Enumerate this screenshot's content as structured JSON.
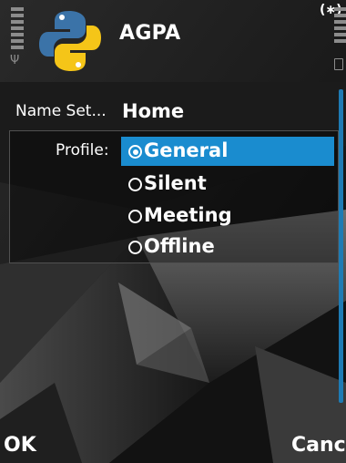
{
  "status": {
    "app_icon": "python-logo-icon",
    "title": "AGPA",
    "signal_icon": "signal-strength-icon",
    "battery_icon": "battery-level-icon",
    "bluetooth_icon": "bluetooth-icon",
    "bluetooth_glyph": "(∗)"
  },
  "form": {
    "name_label": "Name Set...",
    "name_value": "Home",
    "profile_label": "Profile:",
    "options": [
      {
        "label": "General",
        "selected": true
      },
      {
        "label": "Silent",
        "selected": false
      },
      {
        "label": "Meeting",
        "selected": false
      },
      {
        "label": "Offline",
        "selected": false
      }
    ]
  },
  "softkeys": {
    "left": "OK",
    "right": "Cance"
  },
  "colors": {
    "highlight": "#1a8ccf",
    "scrollbar": "#1e7bb4",
    "python_blue": "#3b73a8",
    "python_yellow": "#f5c518"
  }
}
